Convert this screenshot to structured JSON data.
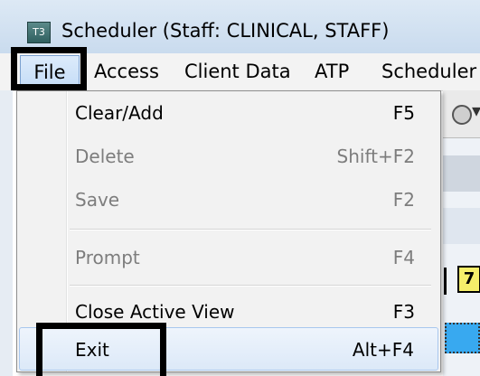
{
  "window": {
    "icon_text": "T3",
    "title": "Scheduler  (Staff: CLINICAL, STAFF)"
  },
  "menubar": {
    "items": [
      "File",
      "Access",
      "Client Data",
      "ATP",
      "Scheduler"
    ]
  },
  "file_menu": {
    "items": [
      {
        "label": "Clear/Add",
        "shortcut": "F5",
        "enabled": true
      },
      {
        "label": "Delete",
        "shortcut": "Shift+F2",
        "enabled": false
      },
      {
        "label": "Save",
        "shortcut": "F2",
        "enabled": false
      },
      {
        "label": "Prompt",
        "shortcut": "F4",
        "enabled": false
      },
      {
        "label": "Close Active View",
        "shortcut": "F3",
        "enabled": true
      },
      {
        "label": "Exit",
        "shortcut": "Alt+F4",
        "enabled": true,
        "highlighted": true
      }
    ]
  },
  "background": {
    "toolbar_tag": "7",
    "tag_color": "#f5ee6a",
    "cell_color": "#38a9f0"
  },
  "colors": {
    "menu_bg": "#f2f2f2",
    "disabled_text": "#7d7d7d",
    "annotation_box": "#000000"
  }
}
